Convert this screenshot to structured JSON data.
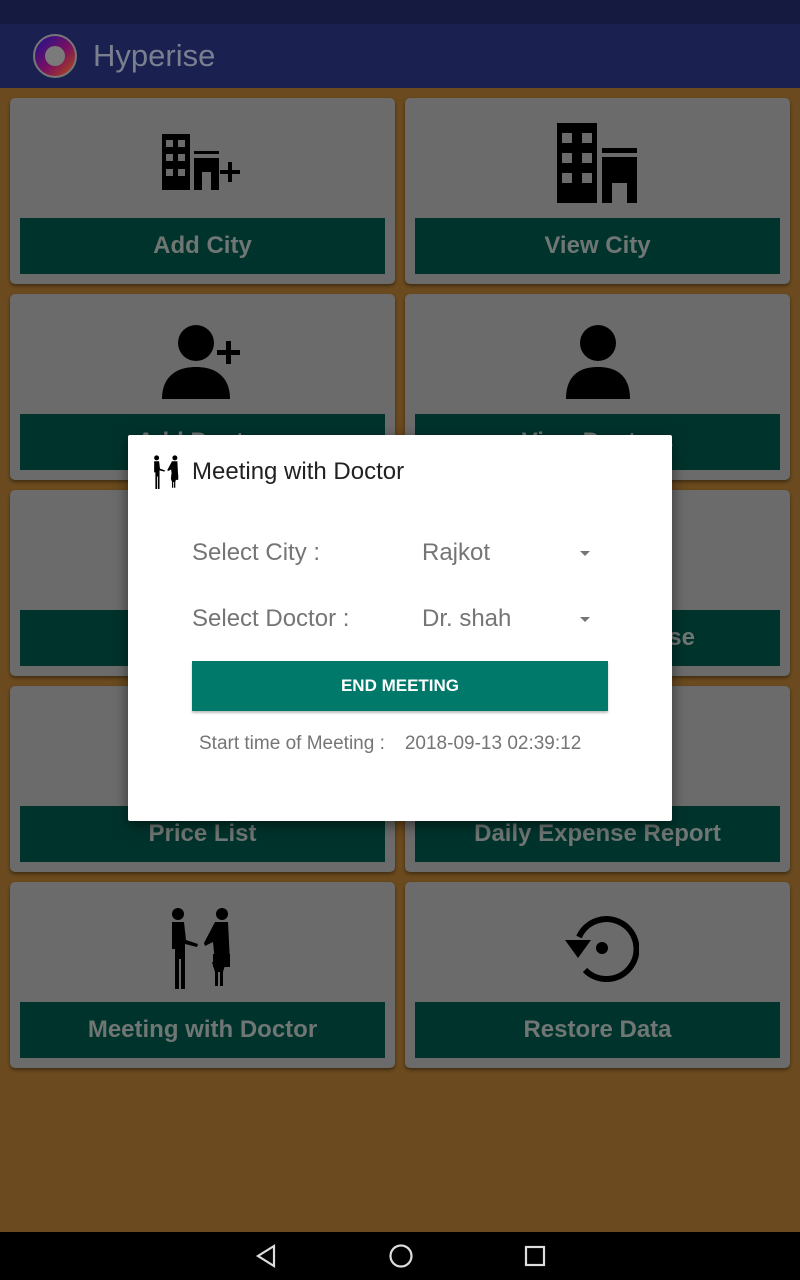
{
  "app": {
    "title": "Hyperise"
  },
  "tiles": [
    {
      "label": "Add City",
      "icon": "add-building-icon"
    },
    {
      "label": "View City",
      "icon": "building-icon"
    },
    {
      "label": "Add Doctor",
      "icon": "add-person-icon"
    },
    {
      "label": "View Doctors",
      "icon": "person-icon"
    },
    {
      "label": "",
      "icon": ""
    },
    {
      "label": "se",
      "icon": ""
    },
    {
      "label": "Price List",
      "icon": ""
    },
    {
      "label": "Daily Expense Report",
      "icon": ""
    },
    {
      "label": "Meeting with Doctor",
      "icon": "handshake-icon"
    },
    {
      "label": "Restore Data",
      "icon": "restore-icon"
    }
  ],
  "dialog": {
    "title": "Meeting with Doctor",
    "city_label": "Select City :",
    "city_value": "Rajkot",
    "doctor_label": "Select Doctor :",
    "doctor_value": "Dr. shah",
    "end_button": "END MEETING",
    "start_label": "Start time of Meeting :",
    "start_value": "2018-09-13 02:39:12"
  },
  "colors": {
    "accent": "#00796b",
    "appbar": "#1a2150",
    "background": "#6a4a1e"
  }
}
